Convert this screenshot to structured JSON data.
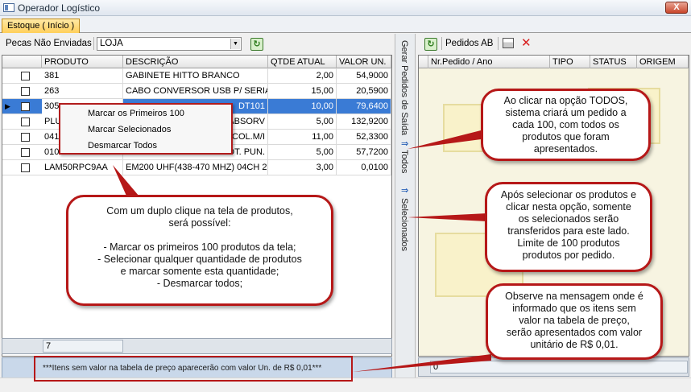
{
  "window": {
    "title": "Operador Logístico",
    "close_label": "X"
  },
  "tabs": [
    {
      "label": "Estoque ( Início )"
    }
  ],
  "left": {
    "filter_label": "Pecas Não Enviadas",
    "filter_value": "LOJA",
    "columns": [
      "PRODUTO",
      "DESCRIÇÃO",
      "QTDE ATUAL",
      "VALOR UN."
    ],
    "rows": [
      {
        "produto": "381",
        "descricao": "GABINETE HITTO BRANCO",
        "qtde": "2,00",
        "valor": "54,9000"
      },
      {
        "produto": "263",
        "descricao": "CABO CONVERSOR USB P/ SERIAL",
        "qtde": "15,00",
        "valor": "20,5900"
      },
      {
        "produto": "305",
        "descricao": "DT101",
        "qtde": "10,00",
        "valor": "79,6400"
      },
      {
        "produto": "PLU",
        "descricao": "ABSORV",
        "qtde": "5,00",
        "valor": "132,9200"
      },
      {
        "produto": "041",
        "descricao": "COL.M/I",
        "qtde": "11,00",
        "valor": "52,3300"
      },
      {
        "produto": "010",
        "descricao": "OT. PUN.",
        "qtde": "5,00",
        "valor": "57,7200"
      },
      {
        "produto": "LAM50RPC9AA",
        "descricao": "EM200 UHF(438-470 MHZ)  04CH  2",
        "qtde": "3,00",
        "valor": "0,0100"
      }
    ],
    "count": "7",
    "message": "***Itens sem valor na tabela de preço aparecerão com valor Un. de R$ 0,01***"
  },
  "side_actions": {
    "gerar": "Gerar Pedidos de Saída",
    "todos": "Todos",
    "selecionados": "Selecionados"
  },
  "right": {
    "toolbar_label": "Pedidos AB",
    "columns": [
      "Nr.Pedido / Ano",
      "TIPO",
      "STATUS",
      "ORIGEM"
    ],
    "count": "0"
  },
  "context_menu": {
    "items": [
      "Marcar os Primeiros 100",
      "Marcar Selecionados",
      "Desmarcar Todos"
    ]
  },
  "callouts": {
    "duplo_clique": [
      "Com um duplo clique na tela de produtos,",
      "será possível:",
      "",
      "- Marcar os primeiros 100 produtos da tela;",
      "- Selecionar qualquer quantidade de produtos",
      "e marcar somente esta quantidade;",
      "- Desmarcar todos;"
    ],
    "todos": [
      "Ao clicar na opção TODOS,",
      "sistema criará um pedido a",
      "cada 100, com todos os",
      "produtos que foram",
      "apresentados."
    ],
    "selecionados": [
      "Após selecionar os produtos e",
      "clicar nesta opção, somente",
      "os selecionados serão",
      "transferidos para este lado.",
      "Limite de 100 produtos",
      "produtos por pedido."
    ],
    "mensagem": [
      "Observe na mensagem onde é",
      "informado que os itens sem",
      "valor na tabela de preço,",
      "serão apresentados com valor",
      "unitário de R$ 0,01."
    ]
  },
  "colors": {
    "accent_red": "#b61818",
    "selection_blue": "#3a7bd5",
    "tab_yellow": "#ffcf5a"
  }
}
